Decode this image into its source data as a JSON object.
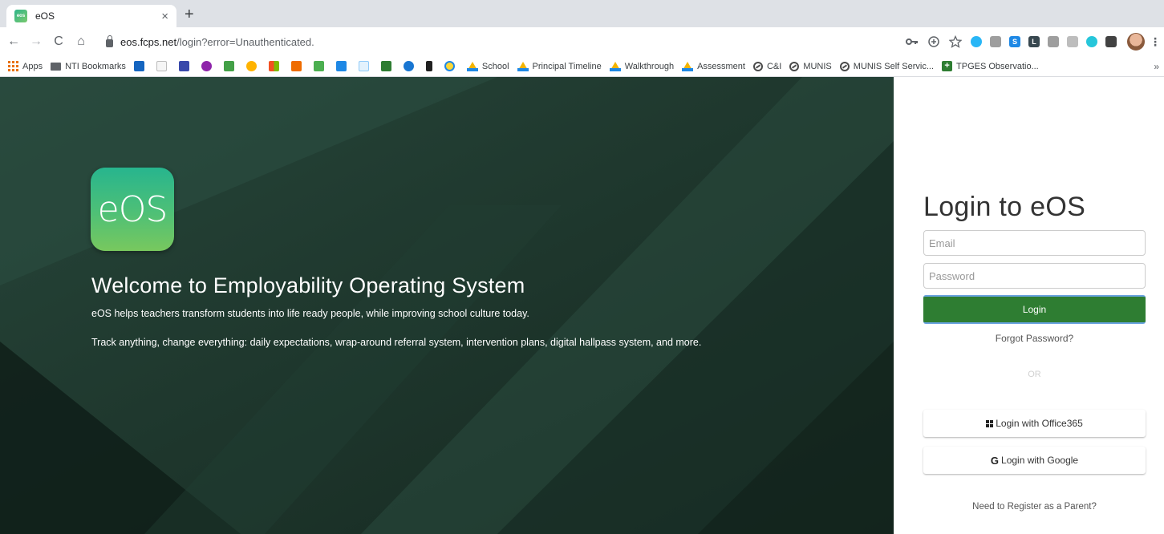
{
  "browser": {
    "tab_title": "eOS",
    "tab_favicon_text": "eos",
    "tab_close": "×",
    "new_tab": "+",
    "url_host": "eos.fcps.net",
    "url_path": "/login?error=Unauthenticated.",
    "nav": {
      "back": "←",
      "forward": "→",
      "reload": "C",
      "home": "⌂"
    },
    "bookmarks": [
      {
        "label": "Apps",
        "icon": "apps-grid-icon"
      },
      {
        "label": "NTI Bookmarks",
        "icon": "folder-icon"
      },
      {
        "label": "School",
        "icon": "google-drive-icon"
      },
      {
        "label": "Principal Timeline",
        "icon": "google-drive-icon"
      },
      {
        "label": "Walkthrough",
        "icon": "google-drive-icon"
      },
      {
        "label": "Assessment",
        "icon": "google-drive-icon"
      },
      {
        "label": "C&I",
        "icon": "munis-icon"
      },
      {
        "label": "MUNIS",
        "icon": "munis-icon"
      },
      {
        "label": "MUNIS Self Servic...",
        "icon": "munis-icon"
      },
      {
        "label": "TPGES Observatio...",
        "icon": "plus-box-icon"
      }
    ],
    "more_bookmarks": "»"
  },
  "hero": {
    "logo_text": "eOS",
    "title": "Welcome to Employability Operating System",
    "subtitle": "eOS helps teachers transform students into life ready people, while improving school culture today.",
    "tagline": "Track anything, change everything: daily expectations, wrap-around referral system, intervention plans, digital hallpass system, and more."
  },
  "login": {
    "title": "Login to eOS",
    "email_placeholder": "Email",
    "password_placeholder": "Password",
    "login_button": "Login",
    "forgot_password": "Forgot Password?",
    "or": "OR",
    "office_button": "Login with Office365",
    "google_button": "Login with Google",
    "register_link": "Need to Register as a Parent?"
  },
  "colors": {
    "hero_bg": "#1d3a30",
    "login_button": "#2e7d32",
    "logo_gradient_top": "#27b58e",
    "logo_gradient_bottom": "#78c85e"
  }
}
